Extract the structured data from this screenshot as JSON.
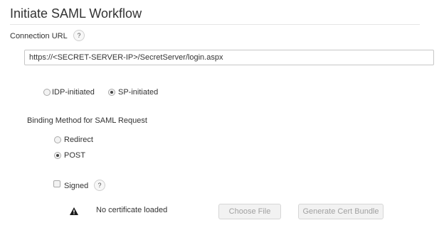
{
  "page": {
    "title": "Initiate SAML Workflow"
  },
  "connection": {
    "label": "Connection URL",
    "help": "?",
    "url_value": "https://<SECRET-SERVER-IP>/SecretServer/login.aspx"
  },
  "initiation": {
    "options": [
      {
        "label": "IDP-initiated",
        "checked": false
      },
      {
        "label": "SP-initiated",
        "checked": true
      }
    ]
  },
  "binding": {
    "label": "Binding Method for SAML Request",
    "options": [
      {
        "label": "Redirect",
        "checked": false
      },
      {
        "label": "POST",
        "checked": true
      }
    ]
  },
  "signed": {
    "label": "Signed",
    "help": "?",
    "checked": false
  },
  "certificate": {
    "status_icon": "warning-icon",
    "status_text": "No certificate loaded",
    "choose_file_label": "Choose File",
    "generate_label": "Generate Cert Bundle"
  }
}
